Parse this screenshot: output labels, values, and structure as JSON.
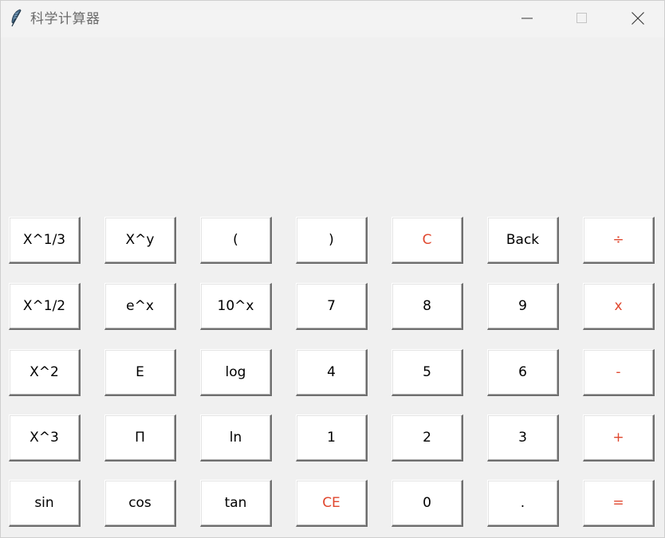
{
  "window": {
    "title": "科学计算器",
    "icon": "feather-icon",
    "controls": [
      "minimize-icon",
      "maximize-icon",
      "close-icon"
    ]
  },
  "display": {
    "value": ""
  },
  "keys": {
    "x_cuberoot": "X^1/3",
    "x_pow_y": "X^y",
    "lparen": "(",
    "rparen": ")",
    "clear": "C",
    "back": "Back",
    "divide": "÷",
    "x_sqrt": "X^1/2",
    "e_pow_x": "e^x",
    "ten_pow_x": "10^x",
    "d7": "7",
    "d8": "8",
    "d9": "9",
    "multiply": "x",
    "x_square": "X^2",
    "e_const": "E",
    "log": "log",
    "d4": "4",
    "d5": "5",
    "d6": "6",
    "minus": "-",
    "x_cube": "X^3",
    "pi": "Π",
    "ln": "ln",
    "d1": "1",
    "d2": "2",
    "d3": "3",
    "plus": "+",
    "sin": "sin",
    "cos": "cos",
    "tan": "tan",
    "clear_entry": "CE",
    "d0": "0",
    "decimal": ".",
    "equals": "="
  },
  "colors": {
    "accent": "#e0472e",
    "background": "#f0f0f0",
    "key_face": "#ffffff"
  }
}
